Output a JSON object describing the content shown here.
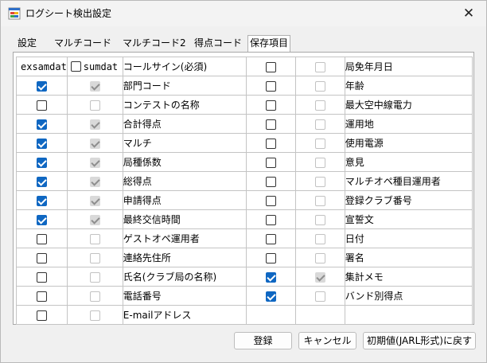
{
  "window": {
    "title": "ログシート検出設定",
    "close_glyph": "✕"
  },
  "tabs": [
    {
      "label": "設定"
    },
    {
      "label": "マルチコード"
    },
    {
      "label": "マルチコード2"
    },
    {
      "label": "得点コード"
    },
    {
      "label": "保存項目"
    }
  ],
  "headers": {
    "exsamdat": "exsamdat",
    "sumdat": "sumdat"
  },
  "rows": [
    {
      "c1": null,
      "c2": null,
      "label": "コールサイン(必須)",
      "c4": false,
      "c5": false,
      "label2": "局免年月日"
    },
    {
      "c1": true,
      "c2": true,
      "label": "部門コード",
      "c4": false,
      "c5": false,
      "label2": "年齢"
    },
    {
      "c1": false,
      "c2": false,
      "label": "コンテストの名称",
      "c4": false,
      "c5": false,
      "label2": "最大空中線電力"
    },
    {
      "c1": true,
      "c2": true,
      "label": "合計得点",
      "c4": false,
      "c5": false,
      "label2": "運用地"
    },
    {
      "c1": true,
      "c2": true,
      "label": "マルチ",
      "c4": false,
      "c5": false,
      "label2": "使用電源"
    },
    {
      "c1": true,
      "c2": true,
      "label": "局種係数",
      "c4": false,
      "c5": false,
      "label2": "意見"
    },
    {
      "c1": true,
      "c2": true,
      "label": "総得点",
      "c4": false,
      "c5": false,
      "label2": "マルチオペ種目運用者"
    },
    {
      "c1": true,
      "c2": true,
      "label": "申請得点",
      "c4": false,
      "c5": false,
      "label2": "登録クラブ番号"
    },
    {
      "c1": true,
      "c2": true,
      "label": "最終交信時間",
      "c4": false,
      "c5": false,
      "label2": "宣誓文"
    },
    {
      "c1": false,
      "c2": false,
      "label": "ゲストオペ運用者",
      "c4": false,
      "c5": false,
      "label2": "日付"
    },
    {
      "c1": false,
      "c2": false,
      "label": "連絡先住所",
      "c4": false,
      "c5": false,
      "label2": "署名"
    },
    {
      "c1": false,
      "c2": false,
      "label": "氏名(クラブ局の名称)",
      "c4": true,
      "c5": true,
      "label2": "集計メモ"
    },
    {
      "c1": false,
      "c2": false,
      "label": "電話番号",
      "c4": true,
      "c5": false,
      "label2": "バンド別得点"
    },
    {
      "c1": false,
      "c2": false,
      "label": "E-mailアドレス",
      "c4": null,
      "c5": null,
      "label2": ""
    }
  ],
  "buttons": {
    "register": "登録",
    "cancel": "キャンセル",
    "reset": "初期値(JARL形式)に戻す"
  },
  "colors": {
    "accent": "#0f67c2",
    "disabled_check": "#d9d9d9"
  }
}
